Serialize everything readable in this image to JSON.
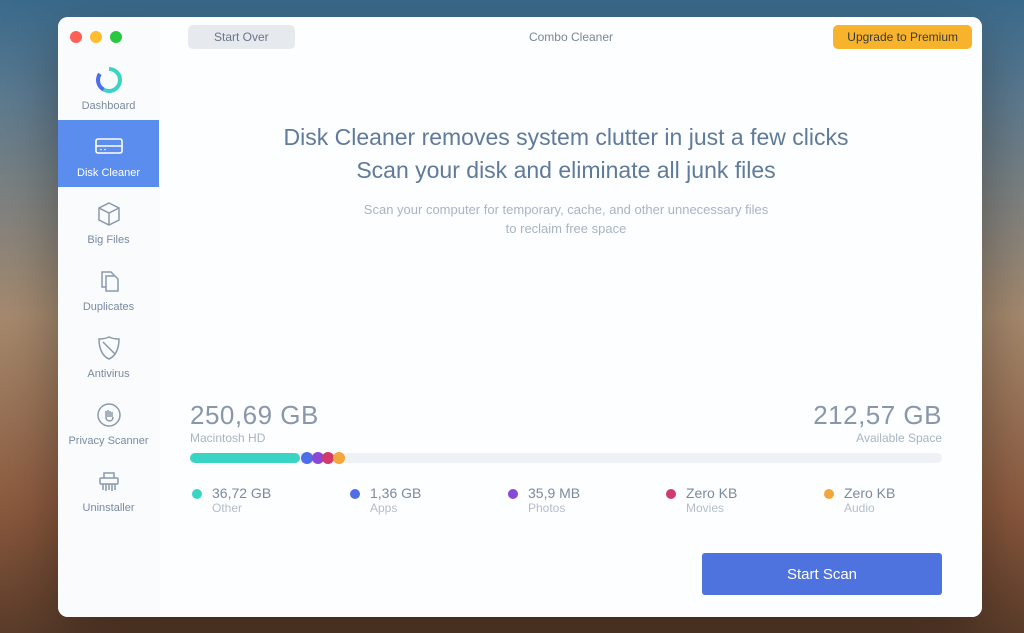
{
  "window": {
    "title": "Combo Cleaner"
  },
  "topbar": {
    "start_over": "Start Over",
    "upgrade": "Upgrade to Premium"
  },
  "sidebar": {
    "items": [
      {
        "label": "Dashboard"
      },
      {
        "label": "Disk Cleaner"
      },
      {
        "label": "Big Files"
      },
      {
        "label": "Duplicates"
      },
      {
        "label": "Antivirus"
      },
      {
        "label": "Privacy Scanner"
      },
      {
        "label": "Uninstaller"
      }
    ],
    "active_index": 1
  },
  "main": {
    "heading_line1": "Disk Cleaner removes system clutter in just a few clicks",
    "heading_line2": "Scan your disk and eliminate all junk files",
    "sub_line1": "Scan your computer for temporary, cache, and other unnecessary files",
    "sub_line2": "to reclaim free space"
  },
  "disk": {
    "used_value": "250,69 GB",
    "used_label": "Macintosh HD",
    "free_value": "212,57 GB",
    "free_label": "Available Space",
    "legend": [
      {
        "value": "36,72 GB",
        "label": "Other",
        "color": "#3ad4c5"
      },
      {
        "value": "1,36 GB",
        "label": "Apps",
        "color": "#4f6de8"
      },
      {
        "value": "35,9 MB",
        "label": "Photos",
        "color": "#8a48d6"
      },
      {
        "value": "Zero KB",
        "label": "Movies",
        "color": "#d13a6a"
      },
      {
        "value": "Zero KB",
        "label": "Audio",
        "color": "#f2a63b"
      }
    ]
  },
  "actions": {
    "scan": "Start Scan"
  }
}
